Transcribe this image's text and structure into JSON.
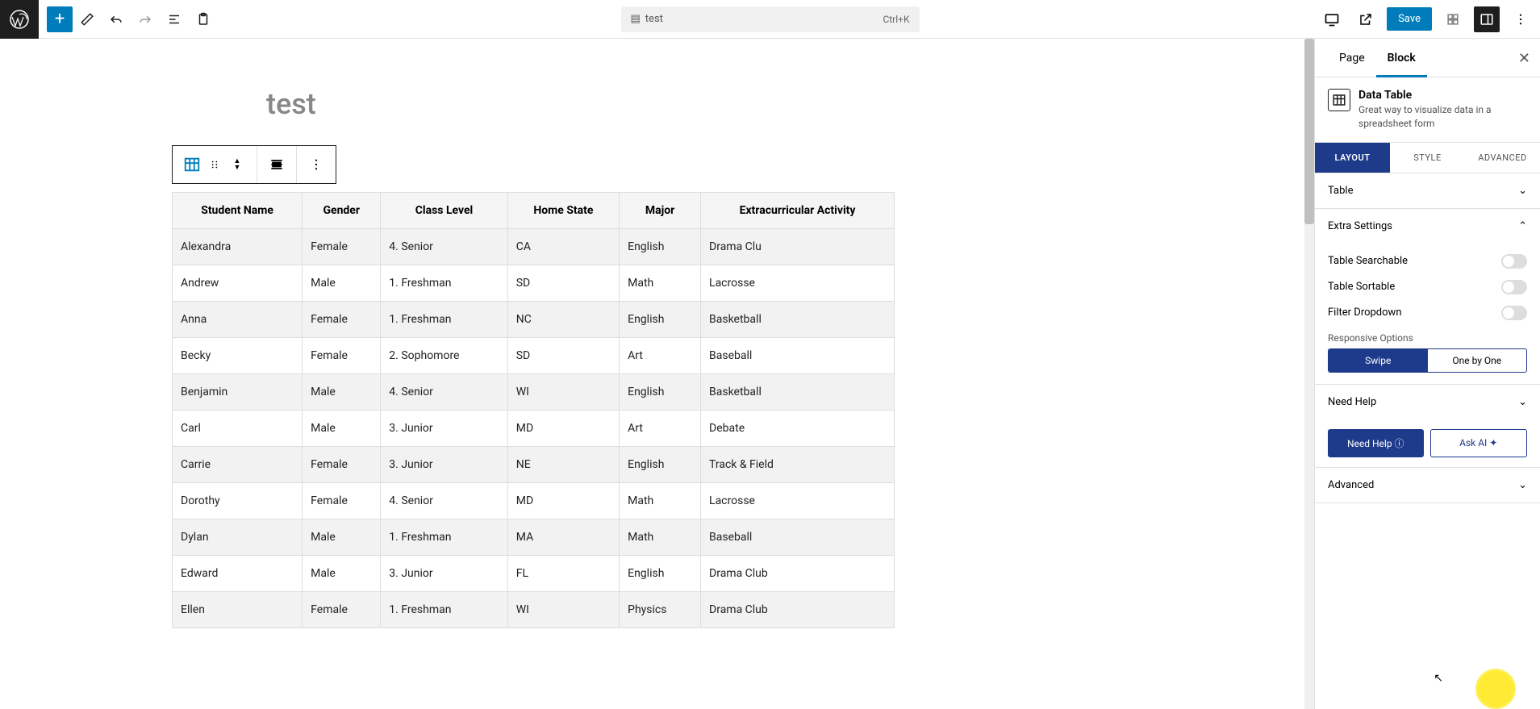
{
  "topbar": {
    "doc_name": "test",
    "shortcut": "Ctrl+K",
    "save_label": "Save"
  },
  "page": {
    "title": "test"
  },
  "table": {
    "headers": [
      "Student Name",
      "Gender",
      "Class Level",
      "Home State",
      "Major",
      "Extracurricular Activity"
    ],
    "rows": [
      [
        "Alexandra",
        "Female",
        "4. Senior",
        "CA",
        "English",
        "Drama Clu"
      ],
      [
        "Andrew",
        "Male",
        "1. Freshman",
        "SD",
        "Math",
        "Lacrosse"
      ],
      [
        "Anna",
        "Female",
        "1. Freshman",
        "NC",
        "English",
        "Basketball"
      ],
      [
        "Becky",
        "Female",
        "2. Sophomore",
        "SD",
        "Art",
        "Baseball"
      ],
      [
        "Benjamin",
        "Male",
        "4. Senior",
        "WI",
        "English",
        "Basketball"
      ],
      [
        "Carl",
        "Male",
        "3. Junior",
        "MD",
        "Art",
        "Debate"
      ],
      [
        "Carrie",
        "Female",
        "3. Junior",
        "NE",
        "English",
        "Track & Field"
      ],
      [
        "Dorothy",
        "Female",
        "4. Senior",
        "MD",
        "Math",
        "Lacrosse"
      ],
      [
        "Dylan",
        "Male",
        "1. Freshman",
        "MA",
        "Math",
        "Baseball"
      ],
      [
        "Edward",
        "Male",
        "3. Junior",
        "FL",
        "English",
        "Drama Club"
      ],
      [
        "Ellen",
        "Female",
        "1. Freshman",
        "WI",
        "Physics",
        "Drama Club"
      ]
    ]
  },
  "sidebar": {
    "tab_page": "Page",
    "tab_block": "Block",
    "block_title": "Data Table",
    "block_desc": "Great way to visualize data in a spreadsheet form",
    "subtabs": {
      "layout": "LAYOUT",
      "style": "STYLE",
      "advanced": "ADVANCED"
    },
    "sections": {
      "table": "Table",
      "extra": "Extra Settings",
      "table_searchable": "Table Searchable",
      "table_sortable": "Table Sortable",
      "filter_dropdown": "Filter Dropdown",
      "responsive_label": "Responsive Options",
      "resp_swipe": "Swipe",
      "resp_onebyone": "One by One",
      "need_help": "Need Help",
      "need_help_btn": "Need Help ⓘ",
      "ask_ai_btn": "Ask AI ✦",
      "advanced": "Advanced"
    }
  }
}
